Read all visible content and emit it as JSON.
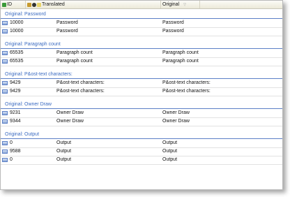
{
  "header": {
    "id_label": "ID",
    "translated_label": "Translated",
    "original_label": "Original",
    "sort_icon": "chevron-down-icon"
  },
  "groups": [
    {
      "title": "Original: Password",
      "rows": [
        {
          "id": "10000",
          "translated": "Password",
          "original": "Password"
        },
        {
          "id": "10000",
          "translated": "Password",
          "original": "Password"
        }
      ]
    },
    {
      "title": "Original: Paragraph count",
      "rows": [
        {
          "id": "65535",
          "translated": "Paragraph count",
          "original": "Paragraph count"
        },
        {
          "id": "65535",
          "translated": "Paragraph count",
          "original": "Paragraph count"
        }
      ]
    },
    {
      "title": "Original: P&ost-text characters:",
      "rows": [
        {
          "id": "9429",
          "translated": "P&ost-text characters:",
          "original": "P&ost-text characters:"
        },
        {
          "id": "9429",
          "translated": "P&ost-text characters:",
          "original": "P&ost-text characters:"
        }
      ]
    },
    {
      "title": "Original: Owner Draw",
      "rows": [
        {
          "id": "9231",
          "translated": "Owner Draw",
          "original": "Owner Draw"
        },
        {
          "id": "9344",
          "translated": "Owner Draw",
          "original": "Owner Draw"
        }
      ]
    },
    {
      "title": "Original: Output",
      "rows": [
        {
          "id": "0",
          "translated": "Output",
          "original": "Output"
        },
        {
          "id": "9588",
          "translated": "Output",
          "original": "Output"
        },
        {
          "id": "0",
          "translated": "Output",
          "original": "Output"
        }
      ]
    }
  ]
}
